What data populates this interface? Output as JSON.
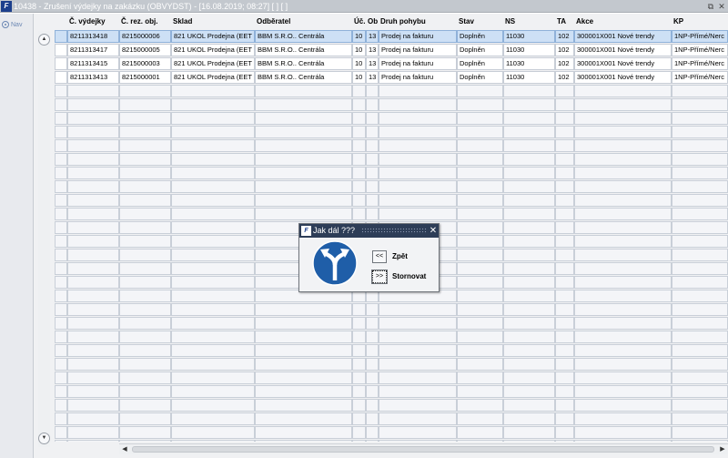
{
  "window": {
    "icon_text": "F",
    "title": "10438 - Zrušení výdejky na zakázku (OBVYDST) - [16.08.2019; 08:27] [ ] [ ]",
    "restore_icon": "⧉",
    "close_icon": "✕"
  },
  "nav": {
    "label": "Nav"
  },
  "table": {
    "columns": [
      {
        "key": "vydejka",
        "label": "Č. výdejky"
      },
      {
        "key": "rezobj",
        "label": "Č. rez. obj."
      },
      {
        "key": "sklad",
        "label": "Sklad"
      },
      {
        "key": "odberatel",
        "label": "Odběratel"
      },
      {
        "key": "uc",
        "label": "Úč."
      },
      {
        "key": "ob",
        "label": "Ob"
      },
      {
        "key": "druh",
        "label": "Druh pohybu"
      },
      {
        "key": "stav",
        "label": "Stav"
      },
      {
        "key": "ns",
        "label": "NS"
      },
      {
        "key": "ta",
        "label": "TA"
      },
      {
        "key": "akce",
        "label": "Akce"
      },
      {
        "key": "kp",
        "label": "KP"
      }
    ],
    "rows": [
      [
        "8211313418",
        "8215000006",
        "821 UKOL Prodejna (EET",
        "BBM S.R.O.. Centrála",
        "10",
        "13",
        "Prodej na fakturu",
        "Doplněn",
        "11030",
        "102",
        "300001X001 Nové trendy",
        "1NP-Přímé/Nerc"
      ],
      [
        "8211313417",
        "8215000005",
        "821 UKOL Prodejna (EET",
        "BBM S.R.O.. Centrála",
        "10",
        "13",
        "Prodej na fakturu",
        "Doplněn",
        "11030",
        "102",
        "300001X001 Nové trendy",
        "1NP-Přímé/Nerc"
      ],
      [
        "8211313415",
        "8215000003",
        "821 UKOL Prodejna (EET",
        "BBM S.R.O.. Centrála",
        "10",
        "13",
        "Prodej na fakturu",
        "Doplněn",
        "11030",
        "102",
        "300001X001 Nové trendy",
        "1NP-Přímé/Nerc"
      ],
      [
        "8211313413",
        "8215000001",
        "821 UKOL Prodejna (EET",
        "BBM S.R.O.. Centrála",
        "10",
        "13",
        "Prodej na fakturu",
        "Doplněn",
        "11030",
        "102",
        "300001X001 Nové trendy",
        "1NP-Přímé/Nerc"
      ]
    ],
    "selected_row": 0,
    "empty_rows": 28
  },
  "scroll": {
    "up_icon": "▲",
    "down_icon": "▼",
    "left_icon": "◀",
    "right_icon": "▶"
  },
  "dialog": {
    "icon_text": "F",
    "title": "Jak dál ???",
    "close_icon": "✕",
    "buttons": [
      {
        "glyph": "<<",
        "label": "Zpět"
      },
      {
        "glyph": ">>",
        "label": "Stornovat"
      }
    ],
    "sign_icon": "fork-arrows-icon",
    "sign_color": "#1f5ea8"
  }
}
